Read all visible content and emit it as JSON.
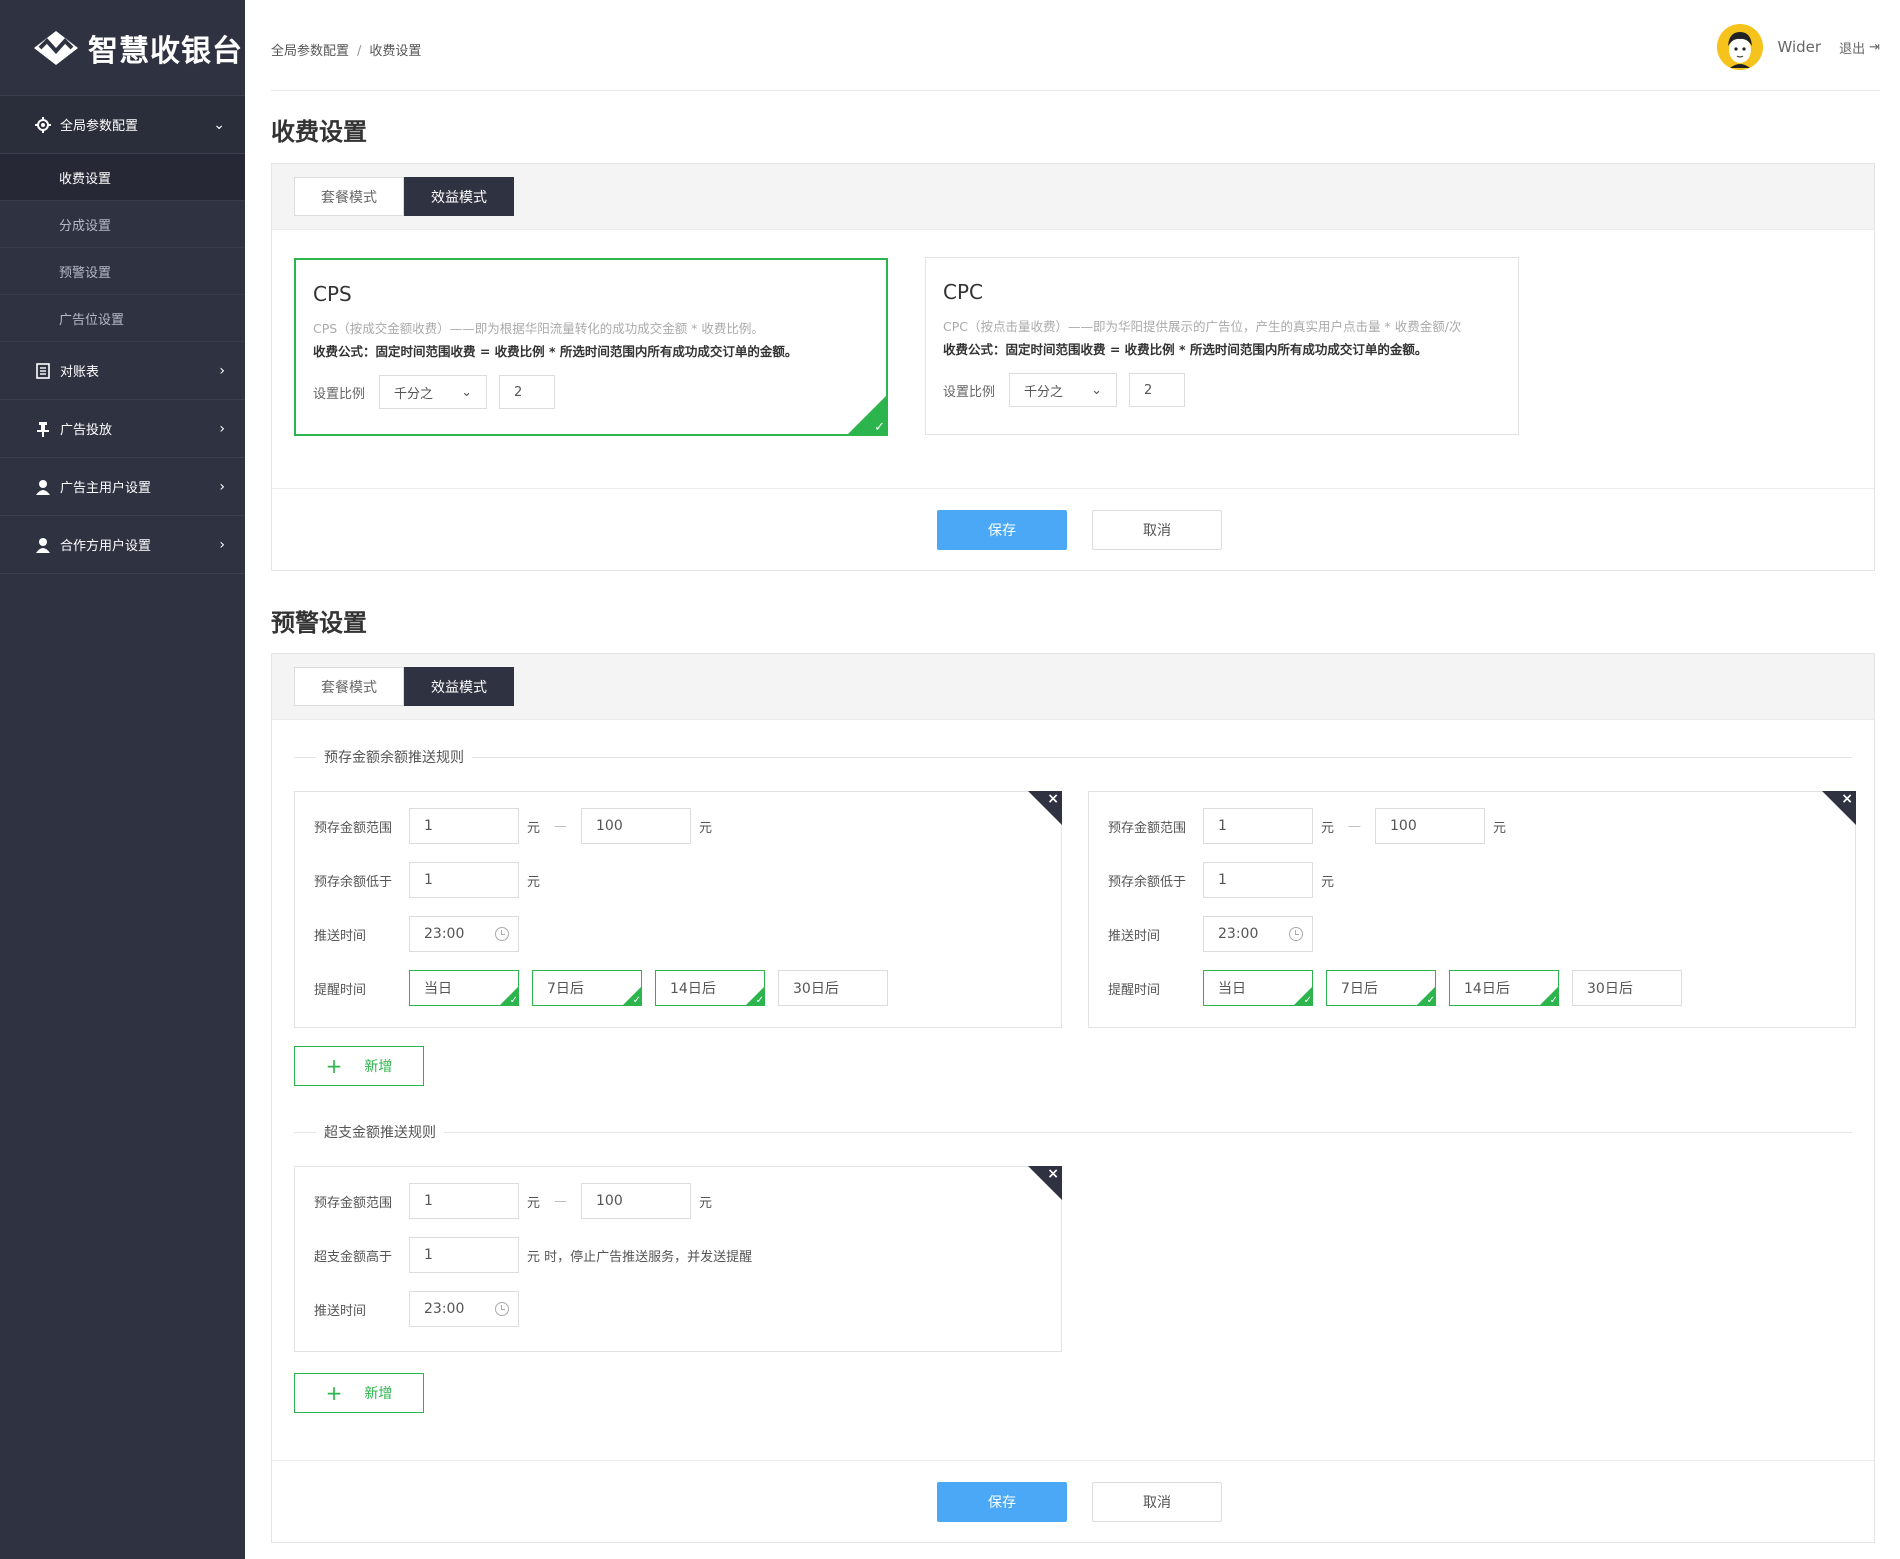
{
  "app": {
    "logo_text": "智慧收银台"
  },
  "sidebar": {
    "groups": [
      {
        "label": "全局参数配置",
        "icon": "gear-icon",
        "expanded": true,
        "items": [
          {
            "label": "收费设置",
            "active": true
          },
          {
            "label": "分成设置"
          },
          {
            "label": "预警设置"
          },
          {
            "label": "广告位设置"
          }
        ]
      },
      {
        "label": "对账表",
        "icon": "document-icon"
      },
      {
        "label": "广告投放",
        "icon": "pin-icon"
      },
      {
        "label": "广告主用户设置",
        "icon": "user-icon"
      },
      {
        "label": "合作方用户设置",
        "icon": "user-icon"
      }
    ]
  },
  "header": {
    "breadcrumb": [
      "全局参数配置",
      "收费设置"
    ],
    "breadcrumb_sep": "/",
    "user_name": "Wider",
    "logout_label": "退出"
  },
  "billing": {
    "title": "收费设置",
    "tabs": [
      {
        "label": "套餐模式"
      },
      {
        "label": "效益模式",
        "active": true
      }
    ],
    "cards": [
      {
        "title": "CPS",
        "selected": true,
        "desc": "CPS（按成交金额收费）——即为根据华阳流量转化的成功成交金额 * 收费比例。",
        "formula": "收费公式：固定时间范围收费 = 收费比例 * 所选时间范围内所有成功成交订单的金额。",
        "ratio_label": "设置比例",
        "ratio_unit": "千分之",
        "ratio_value": "2"
      },
      {
        "title": "CPC",
        "selected": false,
        "desc": "CPC（按点击量收费）——即为华阳提供展示的广告位，产生的真实用户点击量 * 收费金额/次",
        "formula": "收费公式：固定时间范围收费 = 收费比例 * 所选时间范围内所有成功成交订单的金额。",
        "ratio_label": "设置比例",
        "ratio_unit": "千分之",
        "ratio_value": "2"
      }
    ],
    "save_label": "保存",
    "cancel_label": "取消"
  },
  "warning": {
    "title": "预警设置",
    "tabs": [
      {
        "label": "套餐模式"
      },
      {
        "label": "效益模式",
        "active": true
      }
    ],
    "balance_rules_title": "预存金额余额推送规则",
    "labels": {
      "range": "预存金额范围",
      "balance_below": "预存余额低于",
      "push_time": "推送时间",
      "remind_time": "提醒时间",
      "overdraft_above": "超支金额高于",
      "unit": "元",
      "dash": "—",
      "overdraft_suffix": "元 时，停止广告推送服务，并发送提醒"
    },
    "balance_rules": [
      {
        "min": "1",
        "max": "100",
        "below": "1",
        "time": "23:00",
        "remind": [
          {
            "label": "当日",
            "on": true
          },
          {
            "label": "7日后",
            "on": true
          },
          {
            "label": "14日后",
            "on": true
          },
          {
            "label": "30日后",
            "on": false
          }
        ]
      },
      {
        "min": "1",
        "max": "100",
        "below": "1",
        "time": "23:00",
        "remind": [
          {
            "label": "当日",
            "on": true
          },
          {
            "label": "7日后",
            "on": true
          },
          {
            "label": "14日后",
            "on": true
          },
          {
            "label": "30日后",
            "on": false
          }
        ]
      }
    ],
    "add_label": "新增",
    "overdraft_rules_title": "超支金额推送规则",
    "overdraft_rule": {
      "min": "1",
      "max": "100",
      "above": "1",
      "time": "23:00"
    },
    "save_label": "保存",
    "cancel_label": "取消"
  }
}
